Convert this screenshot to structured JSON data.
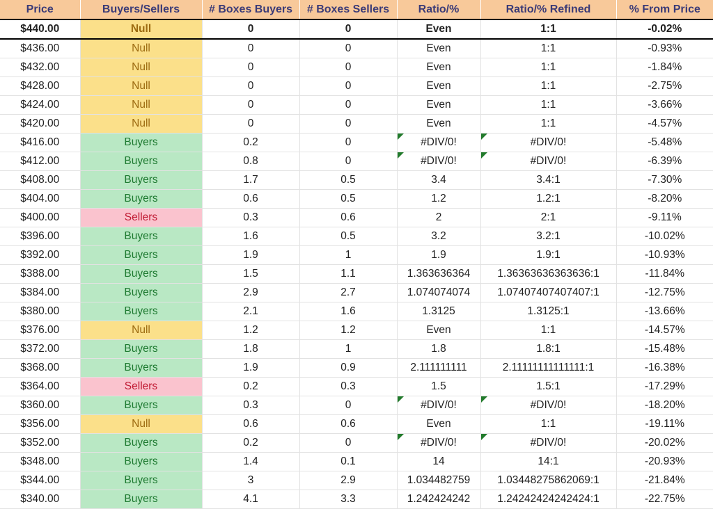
{
  "table": {
    "columns": [
      {
        "key": "price",
        "label": "Price"
      },
      {
        "key": "state",
        "label": "Buyers/Sellers"
      },
      {
        "key": "boxes_buy",
        "label": "# Boxes Buyers"
      },
      {
        "key": "boxes_sell",
        "label": "# Boxes Sellers"
      },
      {
        "key": "ratio",
        "label": "Ratio/%"
      },
      {
        "key": "ratio_ref",
        "label": "Ratio/% Refined"
      },
      {
        "key": "from_price",
        "label": "% From Price"
      }
    ],
    "colors": {
      "header_bg": "#f8c99a",
      "header_text": "#3b3b77",
      "null_bg": "#fbe08a",
      "null_text": "#9c6a10",
      "buyers_bg": "#b9e8c4",
      "buyers_text": "#1e7a31",
      "sellers_bg": "#fac3ce",
      "sellers_text": "#c01a33",
      "error_flag": "#217a2b",
      "grid": "#e2e2e2"
    },
    "rows": [
      {
        "price": "$440.00",
        "state": "Null",
        "state_kind": "null",
        "boxes_buy": "0",
        "boxes_sell": "0",
        "ratio": "Even",
        "ratio_err": false,
        "ratio_ref": "1:1",
        "ratio_ref_err": false,
        "from_price": "-0.02%",
        "highlight": true
      },
      {
        "price": "$436.00",
        "state": "Null",
        "state_kind": "null",
        "boxes_buy": "0",
        "boxes_sell": "0",
        "ratio": "Even",
        "ratio_err": false,
        "ratio_ref": "1:1",
        "ratio_ref_err": false,
        "from_price": "-0.93%",
        "highlight": false
      },
      {
        "price": "$432.00",
        "state": "Null",
        "state_kind": "null",
        "boxes_buy": "0",
        "boxes_sell": "0",
        "ratio": "Even",
        "ratio_err": false,
        "ratio_ref": "1:1",
        "ratio_ref_err": false,
        "from_price": "-1.84%",
        "highlight": false
      },
      {
        "price": "$428.00",
        "state": "Null",
        "state_kind": "null",
        "boxes_buy": "0",
        "boxes_sell": "0",
        "ratio": "Even",
        "ratio_err": false,
        "ratio_ref": "1:1",
        "ratio_ref_err": false,
        "from_price": "-2.75%",
        "highlight": false
      },
      {
        "price": "$424.00",
        "state": "Null",
        "state_kind": "null",
        "boxes_buy": "0",
        "boxes_sell": "0",
        "ratio": "Even",
        "ratio_err": false,
        "ratio_ref": "1:1",
        "ratio_ref_err": false,
        "from_price": "-3.66%",
        "highlight": false
      },
      {
        "price": "$420.00",
        "state": "Null",
        "state_kind": "null",
        "boxes_buy": "0",
        "boxes_sell": "0",
        "ratio": "Even",
        "ratio_err": false,
        "ratio_ref": "1:1",
        "ratio_ref_err": false,
        "from_price": "-4.57%",
        "highlight": false
      },
      {
        "price": "$416.00",
        "state": "Buyers",
        "state_kind": "buyers",
        "boxes_buy": "0.2",
        "boxes_sell": "0",
        "ratio": "#DIV/0!",
        "ratio_err": true,
        "ratio_ref": "#DIV/0!",
        "ratio_ref_err": true,
        "from_price": "-5.48%",
        "highlight": false
      },
      {
        "price": "$412.00",
        "state": "Buyers",
        "state_kind": "buyers",
        "boxes_buy": "0.8",
        "boxes_sell": "0",
        "ratio": "#DIV/0!",
        "ratio_err": true,
        "ratio_ref": "#DIV/0!",
        "ratio_ref_err": true,
        "from_price": "-6.39%",
        "highlight": false
      },
      {
        "price": "$408.00",
        "state": "Buyers",
        "state_kind": "buyers",
        "boxes_buy": "1.7",
        "boxes_sell": "0.5",
        "ratio": "3.4",
        "ratio_err": false,
        "ratio_ref": "3.4:1",
        "ratio_ref_err": false,
        "from_price": "-7.30%",
        "highlight": false
      },
      {
        "price": "$404.00",
        "state": "Buyers",
        "state_kind": "buyers",
        "boxes_buy": "0.6",
        "boxes_sell": "0.5",
        "ratio": "1.2",
        "ratio_err": false,
        "ratio_ref": "1.2:1",
        "ratio_ref_err": false,
        "from_price": "-8.20%",
        "highlight": false
      },
      {
        "price": "$400.00",
        "state": "Sellers",
        "state_kind": "sellers",
        "boxes_buy": "0.3",
        "boxes_sell": "0.6",
        "ratio": "2",
        "ratio_err": false,
        "ratio_ref": "2:1",
        "ratio_ref_err": false,
        "from_price": "-9.11%",
        "highlight": false
      },
      {
        "price": "$396.00",
        "state": "Buyers",
        "state_kind": "buyers",
        "boxes_buy": "1.6",
        "boxes_sell": "0.5",
        "ratio": "3.2",
        "ratio_err": false,
        "ratio_ref": "3.2:1",
        "ratio_ref_err": false,
        "from_price": "-10.02%",
        "highlight": false
      },
      {
        "price": "$392.00",
        "state": "Buyers",
        "state_kind": "buyers",
        "boxes_buy": "1.9",
        "boxes_sell": "1",
        "ratio": "1.9",
        "ratio_err": false,
        "ratio_ref": "1.9:1",
        "ratio_ref_err": false,
        "from_price": "-10.93%",
        "highlight": false
      },
      {
        "price": "$388.00",
        "state": "Buyers",
        "state_kind": "buyers",
        "boxes_buy": "1.5",
        "boxes_sell": "1.1",
        "ratio": "1.363636364",
        "ratio_err": false,
        "ratio_ref": "1.36363636363636:1",
        "ratio_ref_err": false,
        "from_price": "-11.84%",
        "highlight": false
      },
      {
        "price": "$384.00",
        "state": "Buyers",
        "state_kind": "buyers",
        "boxes_buy": "2.9",
        "boxes_sell": "2.7",
        "ratio": "1.074074074",
        "ratio_err": false,
        "ratio_ref": "1.07407407407407:1",
        "ratio_ref_err": false,
        "from_price": "-12.75%",
        "highlight": false
      },
      {
        "price": "$380.00",
        "state": "Buyers",
        "state_kind": "buyers",
        "boxes_buy": "2.1",
        "boxes_sell": "1.6",
        "ratio": "1.3125",
        "ratio_err": false,
        "ratio_ref": "1.3125:1",
        "ratio_ref_err": false,
        "from_price": "-13.66%",
        "highlight": false
      },
      {
        "price": "$376.00",
        "state": "Null",
        "state_kind": "null",
        "boxes_buy": "1.2",
        "boxes_sell": "1.2",
        "ratio": "Even",
        "ratio_err": false,
        "ratio_ref": "1:1",
        "ratio_ref_err": false,
        "from_price": "-14.57%",
        "highlight": false
      },
      {
        "price": "$372.00",
        "state": "Buyers",
        "state_kind": "buyers",
        "boxes_buy": "1.8",
        "boxes_sell": "1",
        "ratio": "1.8",
        "ratio_err": false,
        "ratio_ref": "1.8:1",
        "ratio_ref_err": false,
        "from_price": "-15.48%",
        "highlight": false
      },
      {
        "price": "$368.00",
        "state": "Buyers",
        "state_kind": "buyers",
        "boxes_buy": "1.9",
        "boxes_sell": "0.9",
        "ratio": "2.111111111",
        "ratio_err": false,
        "ratio_ref": "2.11111111111111:1",
        "ratio_ref_err": false,
        "from_price": "-16.38%",
        "highlight": false
      },
      {
        "price": "$364.00",
        "state": "Sellers",
        "state_kind": "sellers",
        "boxes_buy": "0.2",
        "boxes_sell": "0.3",
        "ratio": "1.5",
        "ratio_err": false,
        "ratio_ref": "1.5:1",
        "ratio_ref_err": false,
        "from_price": "-17.29%",
        "highlight": false
      },
      {
        "price": "$360.00",
        "state": "Buyers",
        "state_kind": "buyers",
        "boxes_buy": "0.3",
        "boxes_sell": "0",
        "ratio": "#DIV/0!",
        "ratio_err": true,
        "ratio_ref": "#DIV/0!",
        "ratio_ref_err": true,
        "from_price": "-18.20%",
        "highlight": false
      },
      {
        "price": "$356.00",
        "state": "Null",
        "state_kind": "null",
        "boxes_buy": "0.6",
        "boxes_sell": "0.6",
        "ratio": "Even",
        "ratio_err": false,
        "ratio_ref": "1:1",
        "ratio_ref_err": false,
        "from_price": "-19.11%",
        "highlight": false
      },
      {
        "price": "$352.00",
        "state": "Buyers",
        "state_kind": "buyers",
        "boxes_buy": "0.2",
        "boxes_sell": "0",
        "ratio": "#DIV/0!",
        "ratio_err": true,
        "ratio_ref": "#DIV/0!",
        "ratio_ref_err": true,
        "from_price": "-20.02%",
        "highlight": false
      },
      {
        "price": "$348.00",
        "state": "Buyers",
        "state_kind": "buyers",
        "boxes_buy": "1.4",
        "boxes_sell": "0.1",
        "ratio": "14",
        "ratio_err": false,
        "ratio_ref": "14:1",
        "ratio_ref_err": false,
        "from_price": "-20.93%",
        "highlight": false
      },
      {
        "price": "$344.00",
        "state": "Buyers",
        "state_kind": "buyers",
        "boxes_buy": "3",
        "boxes_sell": "2.9",
        "ratio": "1.034482759",
        "ratio_err": false,
        "ratio_ref": "1.03448275862069:1",
        "ratio_ref_err": false,
        "from_price": "-21.84%",
        "highlight": false
      },
      {
        "price": "$340.00",
        "state": "Buyers",
        "state_kind": "buyers",
        "boxes_buy": "4.1",
        "boxes_sell": "3.3",
        "ratio": "1.242424242",
        "ratio_err": false,
        "ratio_ref": "1.24242424242424:1",
        "ratio_ref_err": false,
        "from_price": "-22.75%",
        "highlight": false
      }
    ]
  }
}
